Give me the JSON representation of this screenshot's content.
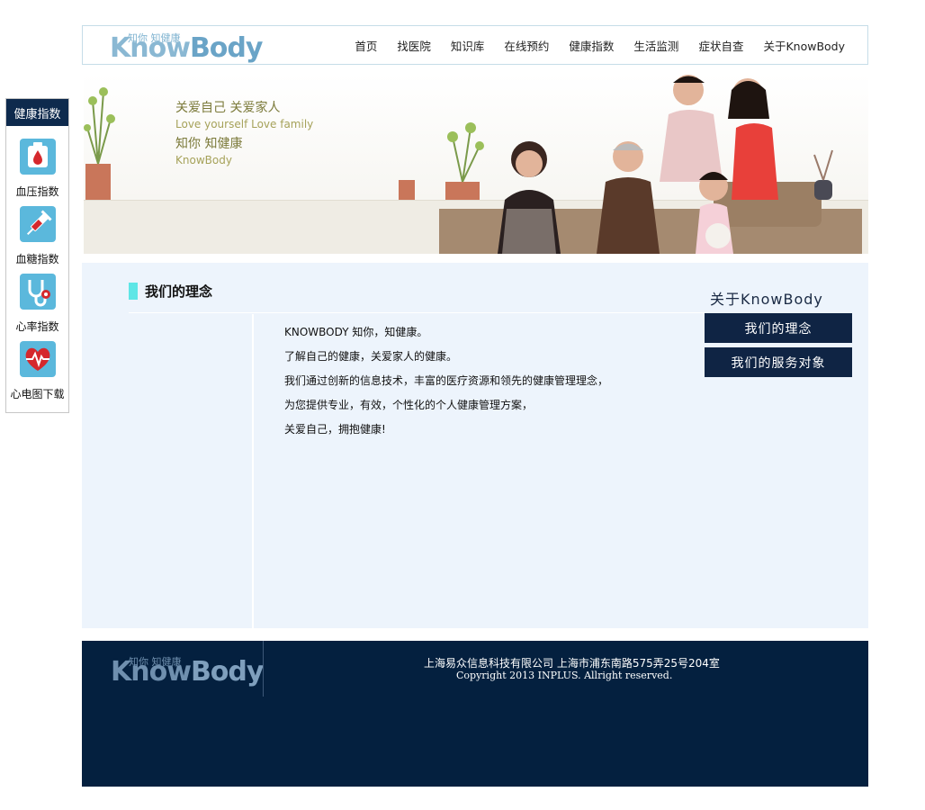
{
  "header": {
    "logo_sub": "知你 知健康",
    "logo_know": "Know",
    "logo_body": "Body",
    "nav": [
      "首页",
      "找医院",
      "知识库",
      "在线预约",
      "健康指数",
      "生活监测",
      "症状自查",
      "关于KnowBody"
    ]
  },
  "side": {
    "title": "健康指数",
    "items": [
      {
        "label": "血压指数",
        "icon": "blood-drop-icon"
      },
      {
        "label": "血糖指数",
        "icon": "syringe-icon"
      },
      {
        "label": "心率指数",
        "icon": "stethoscope-icon"
      },
      {
        "label": "心电图下载",
        "icon": "ecg-heart-icon"
      }
    ]
  },
  "banner": {
    "slogan1": "关爱自己  关爱家人",
    "slogan2": "Love  yourself  Love family",
    "slogan3": "知你  知健康",
    "slogan4": "KnowBody"
  },
  "content": {
    "section_title": "我们的理念",
    "lines": [
      "KNOWBODY 知你，知健康。",
      "了解自己的健康，关爱家人的健康。",
      "我们通过创新的信息技术，丰富的医疗资源和领先的健康管理理念，",
      "为您提供专业，有效，个性化的个人健康管理方案，",
      "关爱自己，拥抱健康!"
    ],
    "about_title": "关于KnowBody",
    "about_buttons": [
      "我们的理念",
      "我们的服务对象"
    ]
  },
  "footer": {
    "address": "上海易众信息科技有限公司 上海市浦东南路575弄25号204室",
    "copyright": "Copyright 2013 INPLUS. Allright reserved."
  },
  "colors": {
    "navy": "#0e2a4d",
    "footer_bg": "#04203f",
    "content_bg": "#edf4fc",
    "accent_cyan": "#5ee6e6",
    "icon_blue": "#5bb8dc"
  }
}
